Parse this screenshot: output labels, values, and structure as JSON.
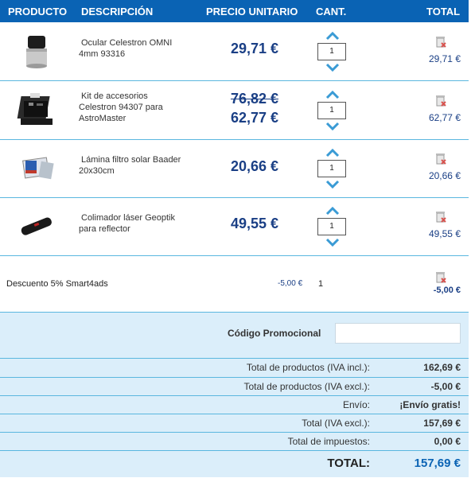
{
  "header": {
    "product": "PRODUCTO",
    "description": "DESCRIPCIÓN",
    "unit_price": "PRECIO UNITARIO",
    "quantity": "CANT.",
    "total": "TOTAL"
  },
  "items": [
    {
      "name_line1": "Ocular Celestron OMNI",
      "name_line2": "4mm 93316",
      "name_line3": "",
      "old_price": "",
      "price": "29,71 €",
      "qty": "1",
      "line_total": "29,71 €",
      "thumb_icon": "eyepiece-icon"
    },
    {
      "name_line1": "Kit de accesorios",
      "name_line2": "Celestron 94307 para",
      "name_line3": "AstroMaster",
      "old_price": "76,82 €",
      "price": "62,77 €",
      "qty": "1",
      "line_total": "62,77 €",
      "thumb_icon": "accessory-kit-icon"
    },
    {
      "name_line1": "Lámina filtro solar Baader",
      "name_line2": "20x30cm",
      "name_line3": "",
      "old_price": "",
      "price": "20,66 €",
      "qty": "1",
      "line_total": "20,66 €",
      "thumb_icon": "solar-filter-icon"
    },
    {
      "name_line1": "Colimador láser Geoptik",
      "name_line2": "para reflector",
      "name_line3": "",
      "old_price": "",
      "price": "49,55 €",
      "qty": "1",
      "line_total": "49,55 €",
      "thumb_icon": "laser-collimator-icon"
    }
  ],
  "discount": {
    "label": "Descuento 5% Smart4ads",
    "unit_value": "-5,00 €",
    "qty": "1",
    "total": "-5,00 €"
  },
  "promo": {
    "label": "Código Promocional",
    "value": ""
  },
  "summary": [
    {
      "label": "Total de productos (IVA incl.):",
      "value": "162,69 €"
    },
    {
      "label": "Total de productos (IVA excl.):",
      "value": "-5,00 €"
    },
    {
      "label": "Envío:",
      "value": "¡Envío gratis!"
    },
    {
      "label": "Total (IVA excl.):",
      "value": "157,69 €"
    },
    {
      "label": "Total de impuestos:",
      "value": "0,00 €"
    }
  ],
  "grand_total": {
    "label": "TOTAL:",
    "value": "157,69 €"
  },
  "colors": {
    "header_bg": "#0a63b4",
    "price_text": "#1a3f85",
    "row_divider": "#5ab7df",
    "summary_bg": "#dbeefa",
    "arrow": "#3a9bd5",
    "delete_mark": "#d9534f"
  }
}
